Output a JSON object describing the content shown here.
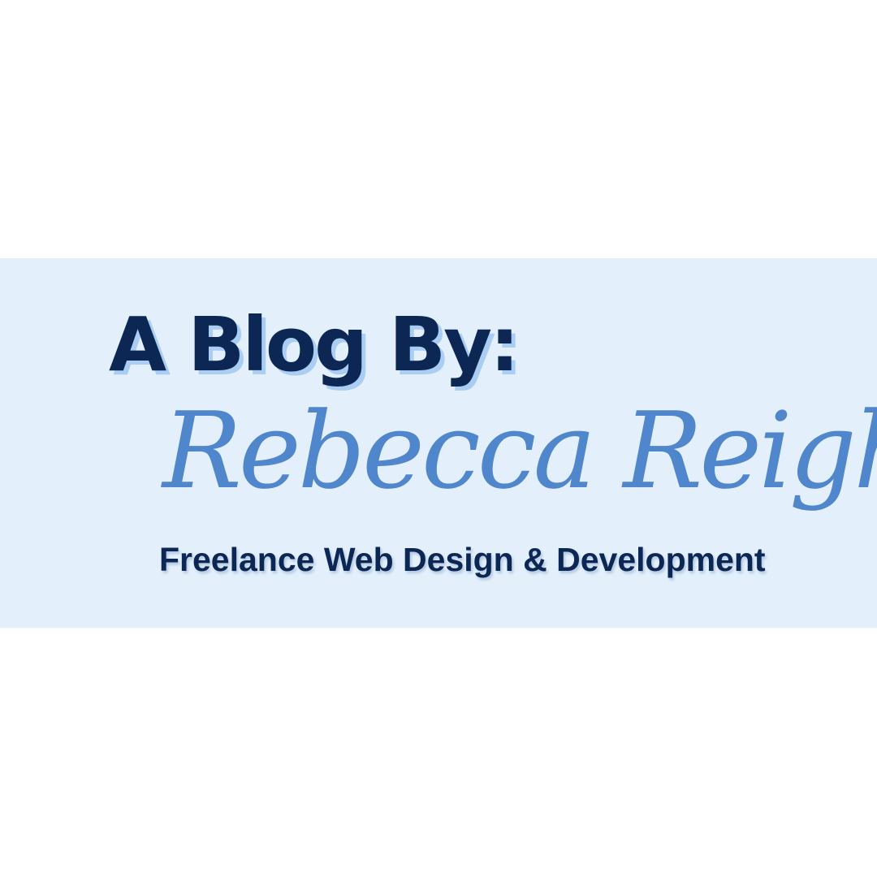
{
  "banner": {
    "heading": "A Blog By:",
    "name": "Rebecca Reigh",
    "tagline": "Freelance Web Design & Development"
  },
  "colors": {
    "background": "#ffffff",
    "banner": "#e3f0fc",
    "navy": "#0c2753",
    "script_blue": "#4f86cc",
    "heading_shadow": "#a9cdf3"
  }
}
